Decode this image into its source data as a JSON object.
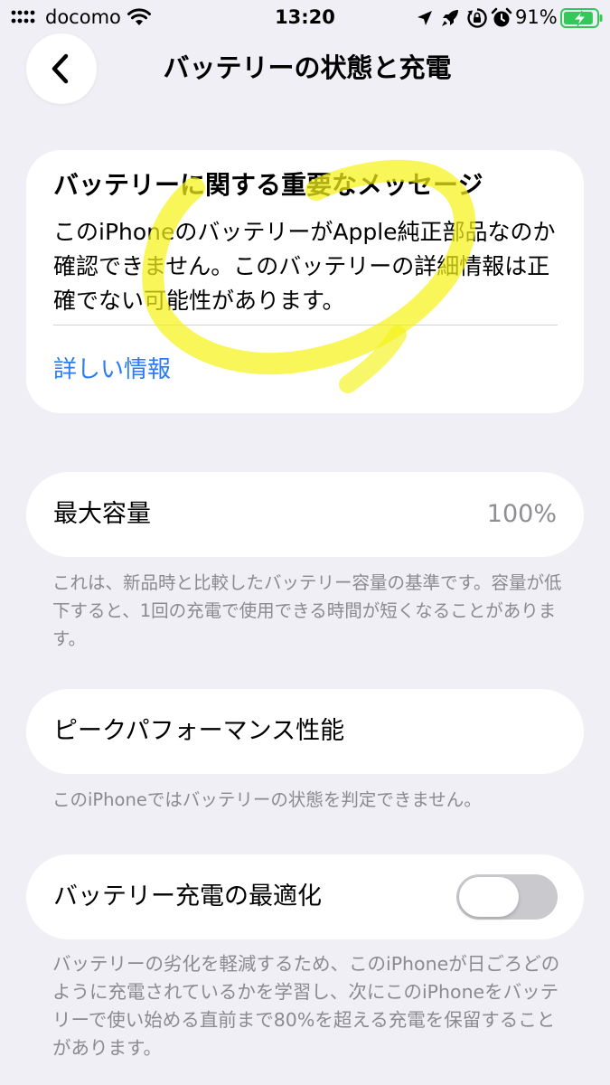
{
  "status_bar": {
    "carrier": "docomo",
    "time": "13:20",
    "battery_percent": "91%",
    "battery_level": 0.91,
    "icons": [
      "signal-icon",
      "wifi-icon",
      "location-icon",
      "rocket-icon",
      "orientation-lock-icon",
      "alarm-icon",
      "battery-charging-icon"
    ]
  },
  "nav": {
    "back_icon": "chevron-left-icon",
    "title": "バッテリーの状態と充電"
  },
  "message_card": {
    "title": "バッテリーに関する重要なメッセージ",
    "body": "このiPhoneのバッテリーがApple純正部品なのか確認できません。このバッテリーの詳細情報は正確でない可能性があります。",
    "link": "詳しい情報"
  },
  "max_capacity": {
    "label": "最大容量",
    "value": "100%",
    "footnote": "これは、新品時と比較したバッテリー容量の基準です。容量が低下すると、1回の充電で使用できる時間が短くなることがあります。"
  },
  "peak_performance": {
    "label": "ピークパフォーマンス性能",
    "footnote": "このiPhoneではバッテリーの状態を判定できません。"
  },
  "optimized_charging": {
    "label": "バッテリー充電の最適化",
    "enabled": false,
    "footnote": "バッテリーの劣化を軽減するため、このiPhoneが日ごろどのように充電されているかを学習し、次にこのiPhoneをバッテリーで使い始める直前まで80%を超える充電を保留することがあります。"
  },
  "colors": {
    "background": "#f0eff5",
    "card": "#ffffff",
    "link": "#2b7cf2",
    "secondary_text": "#8a8a8f",
    "toggle_off": "#c9c9ce",
    "battery_green": "#34c759",
    "highlighter": "#f5f219"
  }
}
